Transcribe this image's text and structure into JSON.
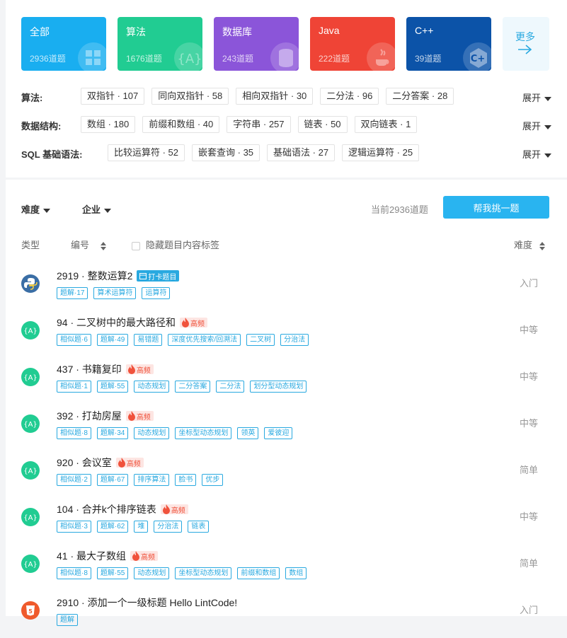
{
  "cards": [
    {
      "title": "全部",
      "count": "2936道题",
      "color": "#19aef0",
      "icon": "grid-icon"
    },
    {
      "title": "算法",
      "count": "1676道题",
      "color": "#21cc92",
      "icon": "algorithm-icon"
    },
    {
      "title": "数据库",
      "count": "243道题",
      "color": "#8b55d9",
      "icon": "database-icon"
    },
    {
      "title": "Java",
      "count": "222道题",
      "color": "#ef4436",
      "icon": "java-icon"
    },
    {
      "title": "C++",
      "count": "39道题",
      "color": "#0c53a8",
      "icon": "cpp-icon"
    }
  ],
  "more_card": {
    "label": "更多",
    "icon": "arrow-right-icon"
  },
  "tag_rows": [
    {
      "label": "算法:",
      "tags": [
        "双指针 · 107",
        "同向双指针 · 58",
        "相向双指针 · 30",
        "二分法 · 96",
        "二分答案 · 28"
      ],
      "expand": "展开"
    },
    {
      "label": "数据结构:",
      "tags": [
        "数组 · 180",
        "前缀和数组 · 40",
        "字符串 · 257",
        "链表 · 50",
        "双向链表 · 1"
      ],
      "expand": "展开"
    },
    {
      "label": "SQL 基础语法:",
      "tags": [
        "比较运算符 · 52",
        "嵌套查询 · 35",
        "基础语法 · 27",
        "逻辑运算符 · 25"
      ],
      "expand": "展开"
    }
  ],
  "filters": {
    "difficulty": "难度",
    "company": "企业"
  },
  "count_text": "当前2936道题",
  "pick_button": "帮我挑一题",
  "list_header": {
    "type": "类型",
    "number": "编号",
    "hide_tags": "隐藏题目内容标签",
    "difficulty": "难度"
  },
  "problems": [
    {
      "type": "python",
      "title": "2919 · 整数运算2",
      "badge": "checkin",
      "badge_text": "打卡题目",
      "tags": [
        "题解·17",
        "算术运算符",
        "运算符"
      ],
      "difficulty": "入门"
    },
    {
      "type": "algorithm",
      "title": "94 · 二叉树中的最大路径和",
      "badge": "hot",
      "badge_text": "高频",
      "tags": [
        "相似题·6",
        "题解·49",
        "易错题",
        "深度优先搜索/回溯法",
        "二叉树",
        "分治法"
      ],
      "difficulty": "中等"
    },
    {
      "type": "algorithm",
      "title": "437 · 书籍复印",
      "badge": "hot",
      "badge_text": "高频",
      "tags": [
        "相似题·1",
        "题解·55",
        "动态规划",
        "二分答案",
        "二分法",
        "划分型动态规划"
      ],
      "difficulty": "中等"
    },
    {
      "type": "algorithm",
      "title": "392 · 打劫房屋",
      "badge": "hot",
      "badge_text": "高频",
      "tags": [
        "相似题·8",
        "题解·34",
        "动态规划",
        "坐标型动态规划",
        "领英",
        "爱彼迎"
      ],
      "difficulty": "中等"
    },
    {
      "type": "algorithm",
      "title": "920 · 会议室",
      "badge": "hot",
      "badge_text": "高频",
      "tags": [
        "相似题·2",
        "题解·67",
        "排序算法",
        "脸书",
        "优步"
      ],
      "difficulty": "简单"
    },
    {
      "type": "algorithm",
      "title": "104 · 合并k个排序链表",
      "badge": "hot",
      "badge_text": "高频",
      "tags": [
        "相似题·3",
        "题解·62",
        "堆",
        "分治法",
        "链表"
      ],
      "difficulty": "中等"
    },
    {
      "type": "algorithm",
      "title": "41 · 最大子数组",
      "badge": "hot",
      "badge_text": "高频",
      "tags": [
        "相似题·8",
        "题解·55",
        "动态规划",
        "坐标型动态规划",
        "前缀和数组",
        "数组"
      ],
      "difficulty": "简单"
    },
    {
      "type": "html",
      "title": "2910 · 添加一个一级标题 Hello LintCode!",
      "badge": "",
      "badge_text": "",
      "tags": [
        "题解"
      ],
      "difficulty": "入门"
    }
  ]
}
